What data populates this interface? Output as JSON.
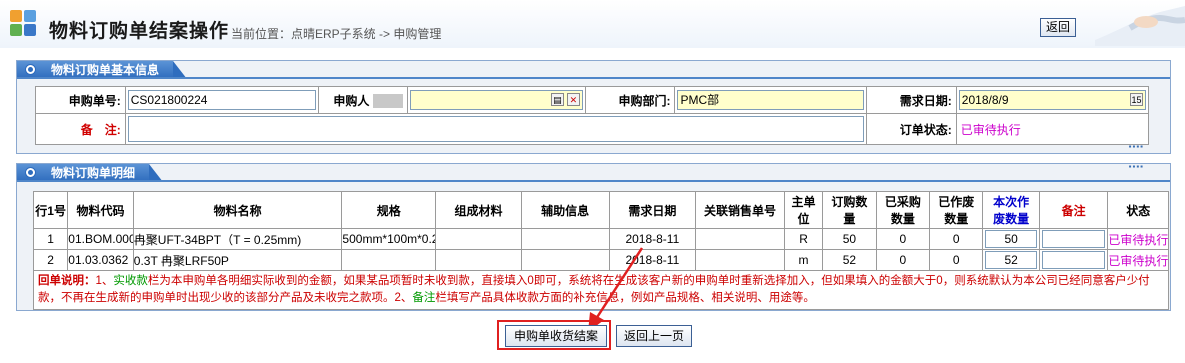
{
  "header": {
    "title": "物料订购单结案操作",
    "breadcrumb": "当前位置：点晴ERP子系统 -> 申购管理",
    "back_button": "返回"
  },
  "basic_panel": {
    "title": "物料订购单基本信息",
    "order_no_label": "申购单号:",
    "order_no_value": "CS021800224",
    "applicant_label": "申购人",
    "applicant_value": "",
    "dept_label": "申购部门:",
    "dept_value": "PMC部",
    "date_label": "需求日期:",
    "date_value": "2018/8/9",
    "remark_label": "备　注:",
    "remark_value": "",
    "status_label": "订单状态:",
    "status_value": "已审待执行"
  },
  "detail_panel": {
    "title": "物料订购单明细",
    "columns": [
      "行1号",
      "物料代码",
      "物料名称",
      "规格",
      "组成材料",
      "辅助信息",
      "需求日期",
      "关联销售单号",
      "主单位",
      "订购数量",
      "已采购数量",
      "已作废数量",
      "本次作废数量",
      "备注",
      "状态"
    ],
    "rows": [
      {
        "no": "1",
        "code": "01.BOM.000",
        "name": "冉聚UFT-34BPT（T = 0.25mm)",
        "spec": "500mm*100m*0.2",
        "material": "",
        "aux": "",
        "date": "2018-8-11",
        "sales_no": "",
        "unit": "R",
        "qty": "50",
        "purchased": "0",
        "cancelled": "0",
        "this_cancel": "50",
        "remark": "",
        "status": "已审待执行"
      },
      {
        "no": "2",
        "code": "01.03.0362",
        "name": "0.3T 冉聚LRF50P",
        "spec": "",
        "material": "",
        "aux": "",
        "date": "2018-8-11",
        "sales_no": "",
        "unit": "m",
        "qty": "52",
        "purchased": "0",
        "cancelled": "0",
        "this_cancel": "52",
        "remark": "",
        "status": "已审待执行"
      }
    ],
    "note_label": "回单说明：",
    "note_1_prefix": "1、",
    "note_1_key": "实收款",
    "note_1_text": "栏为本申购单各明细实际收到的金额，如果某品项暂时未收到款，直接填入0即可，系统将在生成该客户新的申购单时重新选择加入，但如果填入的金额大于0，则系统默认为本公司已经同意客户少付款，不再在生成新的申购单时出现少收的该部分产品及未收完之款项。2、",
    "note_2_key": "备注",
    "note_2_text": "栏填写产品具体收款方面的补充信息，例如产品规格、相关说明、用途等。"
  },
  "footer": {
    "close_button": "申购单收货结案",
    "back_button": "返回上一页"
  },
  "colors": {
    "accent": "#2d6bbd",
    "highlight_box": "#e02020",
    "status": "#cc00cc"
  }
}
